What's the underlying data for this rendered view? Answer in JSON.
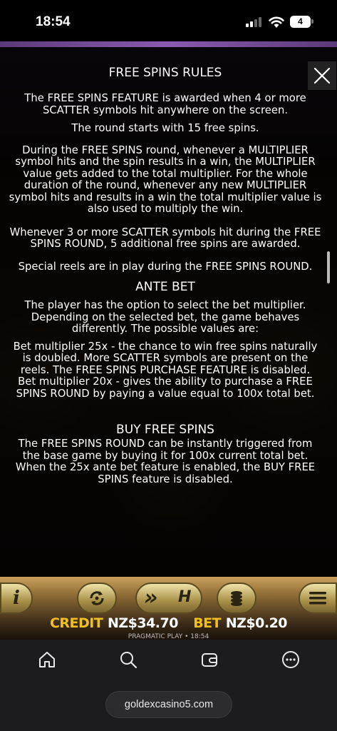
{
  "status_bar": {
    "time": "18:54",
    "battery": "4",
    "icons": [
      "signal-icon",
      "wifi-icon",
      "battery-icon"
    ]
  },
  "rules": {
    "free_spins_title": "FREE SPINS RULES",
    "free_spins_paragraphs": [
      "The FREE SPINS FEATURE is awarded when 4 or more SCATTER symbols hit anywhere on the screen.",
      "The round starts with 15 free spins.",
      "During the FREE SPINS round, whenever a MULTIPLIER symbol hits and the spin results in a win, the MULTIPLIER value gets added to the total multiplier. For the whole duration of the round, whenever any new MULTIPLIER symbol hits and results in a win the total multiplier value is also used to multiply the win.",
      "Whenever 3 or more SCATTER symbols hit during the FREE SPINS ROUND, 5 additional free spins are awarded.",
      "Special reels are in play during the FREE SPINS ROUND."
    ],
    "ante_title": "ANTE BET",
    "ante_paragraph": "The player has the option to select the bet multiplier. Depending on the selected bet, the game behaves differently. The possible values are:",
    "ante_options": [
      "Bet multiplier 25x - the chance to win free spins naturally is doubled. More SCATTER symbols are present on the reels. The FREE SPINS PURCHASE FEATURE is disabled.",
      "Bet multiplier 20x - gives the ability to purchase a FREE SPINS ROUND by paying a value equal to 100x total bet."
    ],
    "buy_title": "BUY FREE SPINS",
    "buy_paragraph": "The FREE SPINS ROUND can be instantly triggered from the base game by buying it for 100x current total bet. When the 25x ante bet feature is enabled, the BUY FREE SPINS feature is disabled."
  },
  "controls": {
    "info_label": "i",
    "turbo_left": "»",
    "turbo_right": "H",
    "credit_label": "CREDIT",
    "credit_value": "NZ$34.70",
    "bet_label": "BET",
    "bet_value": "NZ$0.20",
    "provider": "PRAGMATIC PLAY • 18:54",
    "icons": [
      "info-icon",
      "autoplay-icon",
      "turbo-icon",
      "coins-icon",
      "menu-icon",
      "close-icon"
    ]
  },
  "browser": {
    "url": "goldexcasino5.com",
    "nav_icons": [
      "home-icon",
      "search-icon",
      "wallet-icon",
      "more-icon"
    ]
  },
  "colors": {
    "credit_accent": "#f0c020",
    "controls_gold": "#c9a15a",
    "browser_bg": "#1c1c1e"
  }
}
